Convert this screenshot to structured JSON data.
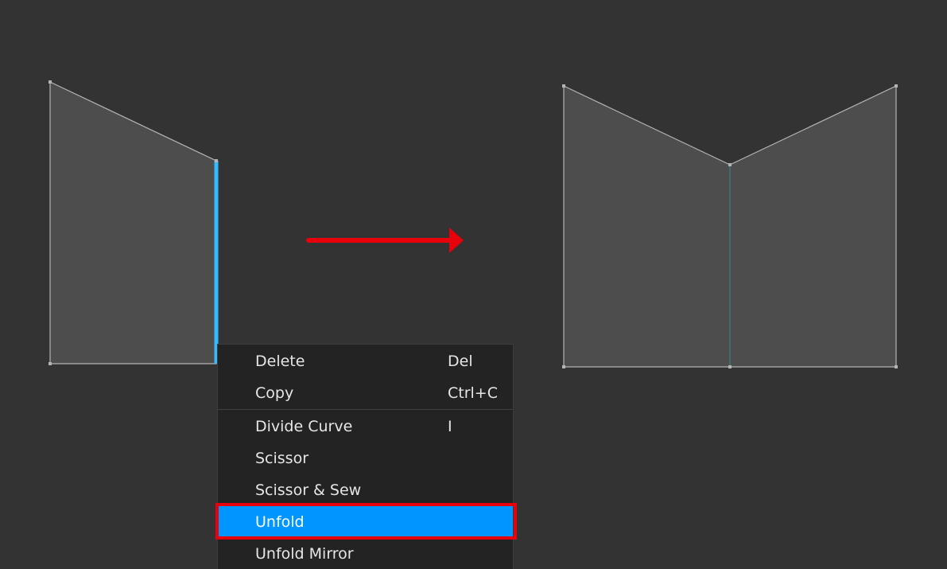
{
  "colors": {
    "background": "#333333",
    "pattern_fill": "#4d4d4d",
    "pattern_outline": "#b4b4b4",
    "selected_edge": "#33bbff",
    "fold_line": "#3f7a86",
    "arrow": "#e8000b",
    "menu_background": "#232323",
    "menu_text": "#e6e6e6",
    "menu_highlight": "#0095ff",
    "highlight_frame": "#e8000b"
  },
  "context_menu": {
    "items": [
      {
        "label": "Delete",
        "shortcut": "Del"
      },
      {
        "label": "Copy",
        "shortcut": "Ctrl+C"
      },
      {
        "label": "Divide Curve",
        "shortcut": "I"
      },
      {
        "label": "Scissor",
        "shortcut": ""
      },
      {
        "label": "Scissor & Sew",
        "shortcut": ""
      },
      {
        "label": "Unfold",
        "shortcut": ""
      },
      {
        "label": "Unfold Mirror",
        "shortcut": ""
      }
    ],
    "highlighted_item": "Unfold"
  },
  "icons": {
    "arrow": "right-arrow-icon"
  }
}
